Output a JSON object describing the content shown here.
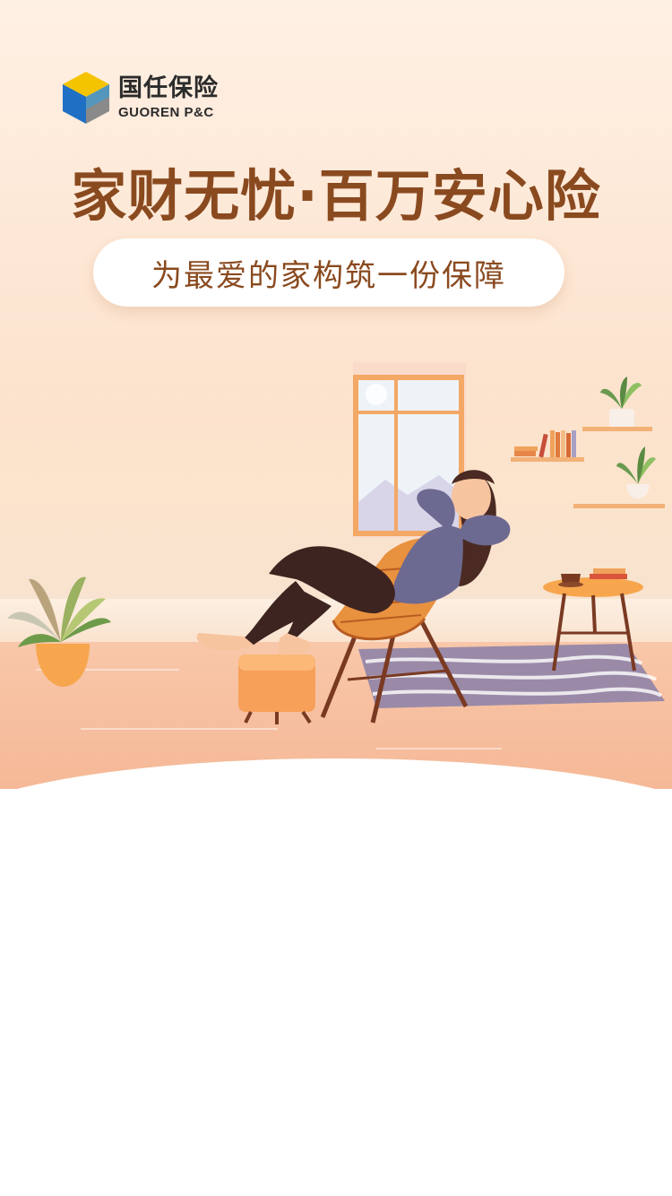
{
  "brand": {
    "name_cn": "国任保险",
    "name_en": "GUOREN P&C",
    "colors": {
      "cube_top": "#f5c400",
      "cube_left": "#1f6fc4",
      "cube_right": "#8a8a8a"
    }
  },
  "banner": {
    "title": "家财无忧·百万安心险",
    "subtitle": "为最爱的家构筑一份保障"
  },
  "illustration": {
    "scene": "woman-relaxing-in-chair"
  },
  "colors": {
    "title": "#8a4a1f",
    "background_top": "#fff0e4",
    "floor": "#f5b896"
  }
}
